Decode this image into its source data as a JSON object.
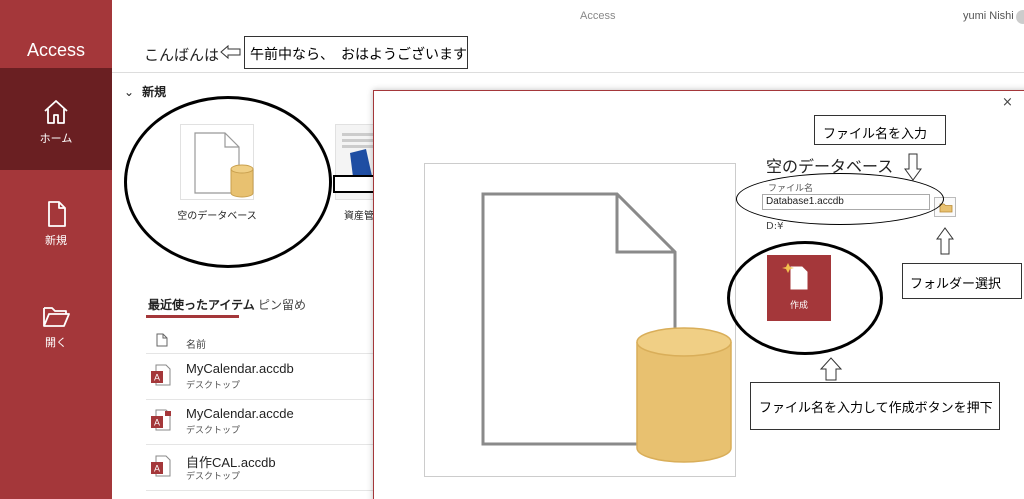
{
  "app": {
    "title": "Access",
    "user_name": "yumi Nishi"
  },
  "sidebar": {
    "title": "Access",
    "items": [
      {
        "label": "ホーム",
        "icon": "home-icon",
        "active": true
      },
      {
        "label": "新規",
        "icon": "new-file-icon",
        "active": false
      },
      {
        "label": "開く",
        "icon": "folder-open-icon",
        "active": false
      }
    ]
  },
  "greeting": {
    "text": "こんばんは",
    "annotation": "午前中なら、　おはようございます"
  },
  "new_section": {
    "title": "新規",
    "templates": [
      {
        "label": "空のデータベース"
      },
      {
        "label": "資産管"
      }
    ]
  },
  "recent": {
    "tabs": [
      {
        "label": "最近使ったアイテム",
        "active": true
      },
      {
        "label": "ピン留め",
        "active": false
      }
    ],
    "column_name": "名前",
    "files": [
      {
        "name": "MyCalendar.accdb",
        "location": "デスクトップ"
      },
      {
        "name": "MyCalendar.accde",
        "location": "デスクトップ"
      },
      {
        "name": "自作CAL.accdb",
        "location": "デスクトップ"
      }
    ]
  },
  "dialog": {
    "title": "空のデータベース",
    "file_name_label": "ファイル名",
    "file_name_value": "Database1.accdb",
    "path": "D:¥",
    "create_label": "作成",
    "close_label": "×"
  },
  "annotations": {
    "enter_filename": "ファイル名を入力",
    "select_folder": "フォルダー選択",
    "enter_and_create": "ファイル名を入力して作成ボタンを押下"
  },
  "colors": {
    "accent": "#a4373a",
    "accent_dark": "#6a1f22",
    "db_gold": "#e8c170"
  }
}
